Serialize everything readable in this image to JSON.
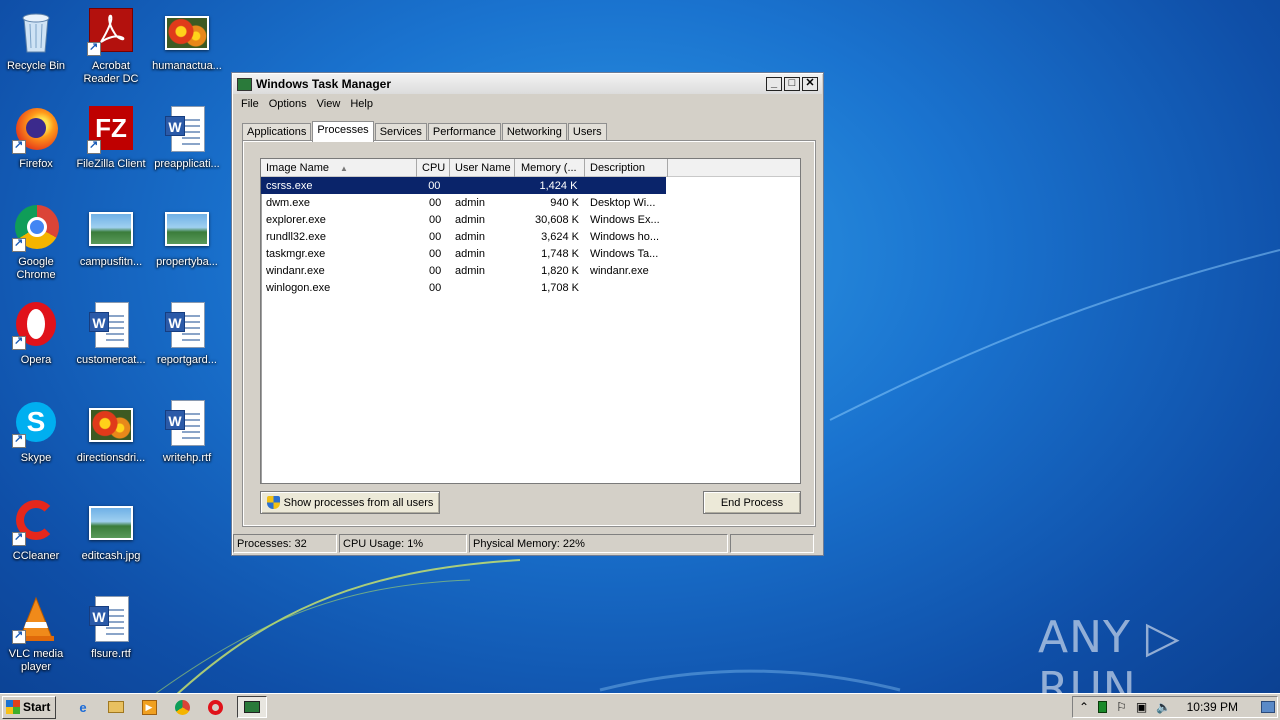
{
  "desktop": {
    "icons": [
      {
        "label": "Recycle Bin",
        "icon": "recycle-bin-icon"
      },
      {
        "label": "Acrobat Reader DC",
        "icon": "acrobat-icon"
      },
      {
        "label": "humanactua...",
        "icon": "image-file-icon"
      },
      {
        "label": "Firefox",
        "icon": "firefox-icon"
      },
      {
        "label": "FileZilla Client",
        "icon": "filezilla-icon"
      },
      {
        "label": "preapplicati...",
        "icon": "word-document-icon"
      },
      {
        "label": "Google Chrome",
        "icon": "chrome-icon"
      },
      {
        "label": "campusfitn...",
        "icon": "image-file-icon"
      },
      {
        "label": "propertyba...",
        "icon": "image-file-icon"
      },
      {
        "label": "Opera",
        "icon": "opera-icon"
      },
      {
        "label": "customercat...",
        "icon": "word-document-icon"
      },
      {
        "label": "reportgard...",
        "icon": "word-document-icon"
      },
      {
        "label": "Skype",
        "icon": "skype-icon"
      },
      {
        "label": "directionsdri...",
        "icon": "image-file-icon"
      },
      {
        "label": "writehp.rtf",
        "icon": "word-document-icon"
      },
      {
        "label": "CCleaner",
        "icon": "ccleaner-icon"
      },
      {
        "label": "editcash.jpg",
        "icon": "image-file-icon"
      },
      {
        "label": "VLC media player",
        "icon": "vlc-icon"
      },
      {
        "label": "flsure.rtf",
        "icon": "word-document-icon"
      }
    ]
  },
  "window": {
    "title": "Windows Task Manager",
    "menu": [
      "File",
      "Options",
      "View",
      "Help"
    ],
    "tabs": [
      "Applications",
      "Processes",
      "Services",
      "Performance",
      "Networking",
      "Users"
    ],
    "active_tab": "Processes",
    "columns": [
      "Image Name",
      "CPU",
      "User Name",
      "Memory (...",
      "Description"
    ],
    "rows": [
      {
        "name": "csrss.exe",
        "cpu": "00",
        "user": "",
        "memory": "1,424 K",
        "desc": "",
        "selected": true
      },
      {
        "name": "dwm.exe",
        "cpu": "00",
        "user": "admin",
        "memory": "940 K",
        "desc": "Desktop Wi..."
      },
      {
        "name": "explorer.exe",
        "cpu": "00",
        "user": "admin",
        "memory": "30,608 K",
        "desc": "Windows Ex..."
      },
      {
        "name": "rundll32.exe",
        "cpu": "00",
        "user": "admin",
        "memory": "3,624 K",
        "desc": "Windows ho..."
      },
      {
        "name": "taskmgr.exe",
        "cpu": "00",
        "user": "admin",
        "memory": "1,748 K",
        "desc": "Windows Ta..."
      },
      {
        "name": "windanr.exe",
        "cpu": "00",
        "user": "admin",
        "memory": "1,820 K",
        "desc": "windanr.exe"
      },
      {
        "name": "winlogon.exe",
        "cpu": "00",
        "user": "",
        "memory": "1,708 K",
        "desc": ""
      }
    ],
    "show_all_label": "Show processes from all users",
    "end_process_label": "End Process",
    "status": {
      "processes": "Processes: 32",
      "cpu": "CPU Usage: 1%",
      "memory": "Physical Memory: 22%"
    }
  },
  "taskbar": {
    "start_label": "Start",
    "clock": "10:39 PM"
  },
  "watermark": "ANY ▷ RUN"
}
